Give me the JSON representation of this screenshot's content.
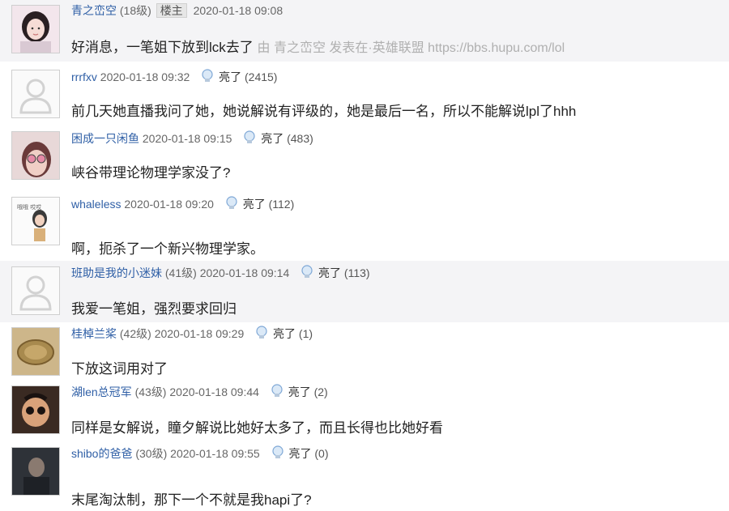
{
  "post0": {
    "user": "青之峦空",
    "level": "(18级)",
    "badge": "楼主",
    "time": "2020-01-18 09:08",
    "text": "好消息，一笔姐下放到lck去了",
    "source": "由 青之峦空 发表在·英雄联盟 https://bbs.hupu.com/lol"
  },
  "post1": {
    "user": "rrrfxv",
    "time": "2020-01-18 09:32",
    "liked": "亮了",
    "count": "(2415)",
    "text": "前几天她直播我问了她，她说解说有评级的，她是最后一名，所以不能解说lpl了hhh"
  },
  "post2": {
    "user": "困成一只闲鱼",
    "time": "2020-01-18 09:15",
    "liked": "亮了",
    "count": "(483)",
    "text": "峡谷带理论物理学家没了?"
  },
  "post3": {
    "user": "whaleless",
    "time": "2020-01-18 09:20",
    "liked": "亮了",
    "count": "(112)",
    "text": "啊，扼杀了一个新兴物理学家。",
    "avatar_text": "哦哦 哎哎"
  },
  "post4": {
    "user": "班助是我的小迷妹",
    "level": "(41级)",
    "time": "2020-01-18 09:14",
    "liked": "亮了",
    "count": "(113)",
    "text": "我爱一笔姐，强烈要求回归"
  },
  "post5": {
    "user": "桂棹兰桨",
    "level": "(42级)",
    "time": "2020-01-18 09:29",
    "liked": "亮了",
    "count": "(1)",
    "text": "下放这词用对了"
  },
  "post6": {
    "user": "湖len总冠军",
    "level": "(43级)",
    "time": "2020-01-18 09:44",
    "liked": "亮了",
    "count": "(2)",
    "text": "同样是女解说，瞳夕解说比她好太多了，而且长得也比她好看"
  },
  "post7": {
    "user": "shibo的爸爸",
    "level": "(30级)",
    "time": "2020-01-18 09:55",
    "liked": "亮了",
    "count": "(0)",
    "text": "末尾淘汰制，那下一个不就是我hapi了?"
  },
  "icons": {
    "like": "lightbulb-icon",
    "placeholder": "default-user-icon"
  },
  "colors": {
    "username": "#2f5fa6",
    "shaded_row": "#f4f4f6",
    "source": "#b0b0b0"
  }
}
